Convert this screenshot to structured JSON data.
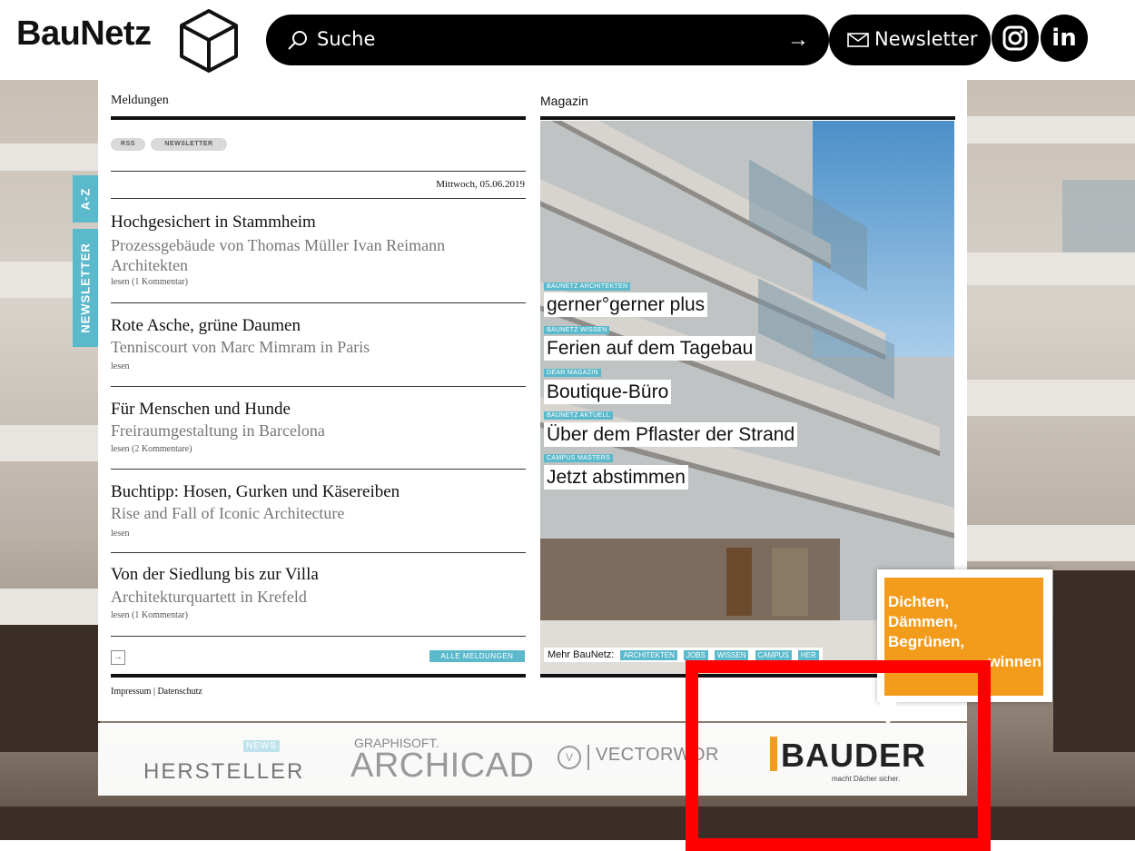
{
  "header": {
    "logo_text": "BauNetz",
    "search_label": "Suche",
    "newsletter_label": "Newsletter",
    "linkedin_label": "in"
  },
  "side_tabs": {
    "az": "A-Z",
    "newsletter": "NEWSLETTER"
  },
  "meldungen": {
    "title": "Meldungen",
    "tags": [
      "RSS",
      "NEWSLETTER"
    ],
    "date": "Mittwoch, 05.06.2019",
    "items": [
      {
        "title": "Hochgesichert in Stammheim",
        "subtitle": "Prozessgebäude von Thomas Müller Ivan Reimann Architekten",
        "link": "lesen (1 Kommentar)"
      },
      {
        "title": "Rote Asche, grüne Daumen",
        "subtitle": "Tenniscourt von Marc Mimram in Paris",
        "link": "lesen"
      },
      {
        "title": "Für Menschen und Hunde",
        "subtitle": "Freiraumgestaltung in Barcelona",
        "link": "lesen (2 Kommentare)"
      },
      {
        "title": "Buchtipp: Hosen, Gurken und Käsereiben",
        "subtitle": "Rise and Fall of Iconic Architecture",
        "link": "lesen"
      },
      {
        "title": "Von der Siedlung bis zur Villa",
        "subtitle": "Architekturquartett in Krefeld",
        "link": "lesen (1 Kommentar)"
      }
    ],
    "alle_label": "ALLE MELDUNGEN",
    "footer": "Impressum | Datenschutz"
  },
  "magazin": {
    "title": "Magazin",
    "stories": [
      {
        "kicker": "BAUNETZ ARCHITEKTEN",
        "headline": "gerner°gerner plus"
      },
      {
        "kicker": "BAUNETZ WISSEN",
        "headline": "Ferien auf dem Tagebau"
      },
      {
        "kicker": "DEAR MAGAZIN",
        "headline": "Boutique-Büro"
      },
      {
        "kicker": "BAUNETZ AKTUELL",
        "headline": "Über dem Pflaster der Strand"
      },
      {
        "kicker": "CAMPUS MASTERS",
        "headline": "Jetzt abstimmen"
      }
    ],
    "mehr_label": "Mehr BauNetz:",
    "mehr_tags": [
      "ARCHITEKTEN",
      "JOBS",
      "WISSEN",
      "CAMPUS",
      "HER"
    ]
  },
  "ad": {
    "lines": [
      "Dichten,",
      "Dämmen,",
      "Begrünen,"
    ],
    "partial": "winnen"
  },
  "partners": {
    "news_badge": "NEWS",
    "hersteller": "HERSTELLER",
    "graphisoft": "GRAPHISOFT.",
    "archicad": "ARCHICAD",
    "vw_symbol": "V",
    "vectorworks": "VECTORWOR",
    "bauder": "BAUDER",
    "bauder_sub": "macht Dächer sicher."
  },
  "colors": {
    "accent": "#5bb9cc",
    "ad_orange": "#f39c1b",
    "highlight": "#ff0000"
  }
}
